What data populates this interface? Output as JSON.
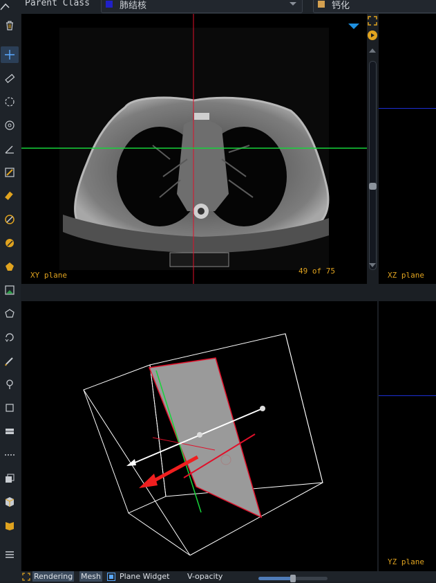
{
  "header": {
    "parent_class_label": "Parent Class",
    "class_selector": {
      "value": "肺结核",
      "color": "#2020c8"
    },
    "sub_selector": {
      "value": "钙化",
      "color": "#d4a050"
    }
  },
  "toolbar": {
    "tools": [
      "trash-icon",
      "crosshair-icon",
      "ruler-icon",
      "circle-select-icon",
      "target-icon",
      "angle-icon",
      "image-edit-icon",
      "eraser-icon",
      "magic-wand-icon",
      "fill-icon",
      "polygon-fill-icon",
      "image-annotate-icon",
      "lasso-icon",
      "redo-lasso-icon",
      "pen-icon",
      "pin-icon",
      "box-select-icon",
      "layers-icon",
      "dashed-line-icon",
      "copy-icon",
      "cube-icon",
      "book-icon",
      "menu-icon"
    ],
    "active_tool": "crosshair-icon"
  },
  "views": {
    "xy": {
      "label": "XY plane",
      "slice_text": "49 of 75"
    },
    "xz": {
      "label": "XZ plane"
    },
    "yz": {
      "label": "YZ plane"
    }
  },
  "statusbar": {
    "rendering_label": "Rendering",
    "mesh_label": "Mesh",
    "plane_widget_label": "Plane Widget",
    "plane_widget_checked": true,
    "v_opacity_label": "V-opacity",
    "v_opacity_value": 0.5
  },
  "colors": {
    "crosshair_vertical": "#e0102a",
    "crosshair_horizontal": "#17d43a",
    "plane_label": "#e0a31f",
    "accent_blue": "#1e90e0"
  }
}
